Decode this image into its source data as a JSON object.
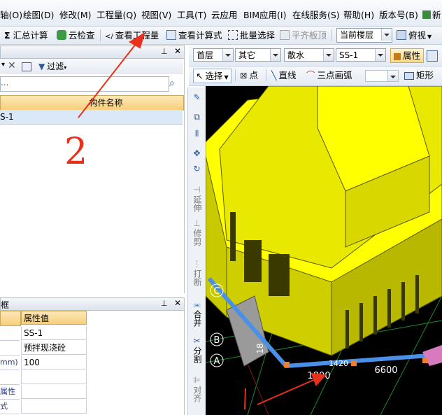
{
  "menubar": {
    "items": [
      "轴(O)",
      "绘图(D)",
      "修改(M)",
      "工程量(Q)",
      "视图(V)",
      "工具(T)",
      "云应用",
      "BIM应用(I)",
      "在线服务(S)",
      "帮助(H)",
      "版本号(B)",
      "新"
    ]
  },
  "toolbar": {
    "sum": "汇总计算",
    "cloud_check": "云检查",
    "view_qty": "查看工程量",
    "view_formula": "查看计算式",
    "batch_select": "批量选择",
    "flush_slab": "平齐板顶",
    "floor_select": "当前楼层",
    "view_mode": "俯视"
  },
  "toolbar2": {
    "floor": "首层",
    "category": "其它",
    "type": "散水",
    "component": "SS-1",
    "properties": "属性",
    "select": "选择",
    "point": "点",
    "line": "直线",
    "arc": "三点画弧",
    "rect": "矩形"
  },
  "left_panel": {
    "filter": "过滤",
    "search_placeholder": "...",
    "column_header": "构件名称",
    "rows": [
      "S-1"
    ],
    "annotation": "2"
  },
  "props_panel": {
    "title": "框",
    "value_header": "属性值",
    "rows": [
      {
        "label": "",
        "value": "SS-1"
      },
      {
        "label": "",
        "value": "预拌现浇砼"
      },
      {
        "label": "mm)",
        "value": "100"
      },
      {
        "label": "",
        "value": ""
      },
      {
        "label": "属性",
        "value": ""
      },
      {
        "label": "式",
        "value": ""
      }
    ]
  },
  "vstrip": {
    "extend": "延伸",
    "trim": "修剪",
    "break": "打断",
    "merge": "合并",
    "split": "分割",
    "align": "对齐"
  },
  "viewport": {
    "axis_c": "C",
    "axis_b": "B",
    "axis_a": "A",
    "dim_1": "1800",
    "dim_2": "6600",
    "dim_3": "1420",
    "dim_v": "18",
    "annotation": "1"
  },
  "colors": {
    "accent": "#ffff00",
    "arrow": "#e8301c",
    "blue_edge": "#4a90e8"
  }
}
